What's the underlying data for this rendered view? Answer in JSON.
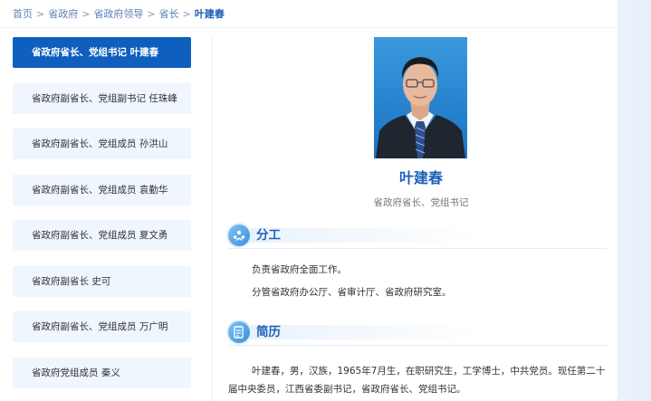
{
  "breadcrumb": {
    "items": [
      "首页",
      "省政府",
      "省政府领导",
      "省长"
    ],
    "current": "叶建春",
    "separator": ">"
  },
  "sidebar": {
    "items": [
      {
        "label": "省政府省长、党组书记  叶建春",
        "active": true
      },
      {
        "label": "省政府副省长、党组副书记  任珠峰",
        "active": false
      },
      {
        "label": "省政府副省长、党组成员  孙洪山",
        "active": false
      },
      {
        "label": "省政府副省长、党组成员  袁勤华",
        "active": false
      },
      {
        "label": "省政府副省长、党组成员  夏文勇",
        "active": false
      },
      {
        "label": "省政府副省长  史可",
        "active": false
      },
      {
        "label": "省政府副省长、党组成员  万广明",
        "active": false
      },
      {
        "label": "省政府党组成员  秦义",
        "active": false
      }
    ]
  },
  "profile": {
    "name": "叶建春",
    "title": "省政府省长、党组书记"
  },
  "duties": {
    "heading": "分工",
    "lines": [
      "负责省政府全面工作。",
      "分管省政府办公厅、省审计厅、省政府研究室。"
    ]
  },
  "resume": {
    "heading": "简历",
    "text": "叶建春，男，汉族，1965年7月生，在职研究生，工学博士，中共党员。现任第二十届中央委员，江西省委副书记，省政府省长、党组书记。"
  },
  "colors": {
    "accent": "#1c5fb8",
    "active_bg": "#0f5fbf",
    "item_bg": "#eff6fd"
  }
}
